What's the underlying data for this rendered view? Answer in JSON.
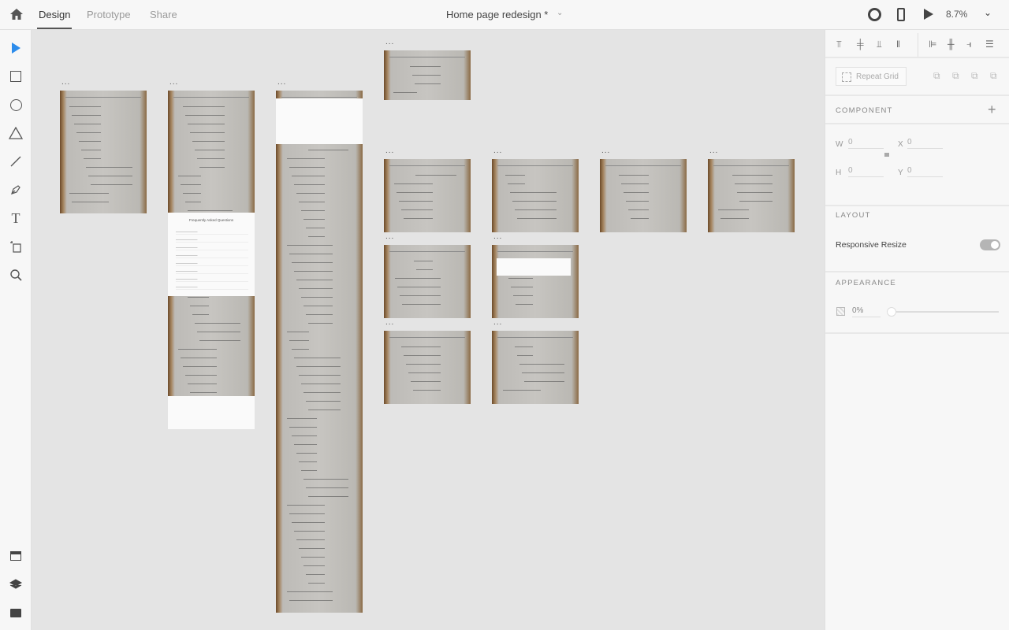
{
  "topbar": {
    "tabs": [
      {
        "label": "Design",
        "active": true
      },
      {
        "label": "Prototype"
      },
      {
        "label": "Share"
      }
    ],
    "document_title": "Home page redesign *",
    "zoom": "8.7%"
  },
  "tools": [
    "select",
    "rectangle",
    "ellipse",
    "triangle",
    "line",
    "pen",
    "text",
    "artboard",
    "zoom"
  ],
  "bottom_tools": [
    "assets",
    "layers",
    "plugins"
  ],
  "panel": {
    "repeat_grid": "Repeat Grid",
    "component": {
      "heading": "COMPONENT"
    },
    "transform": {
      "w_label": "W",
      "w": "0",
      "h_label": "H",
      "h": "0",
      "x_label": "X",
      "x": "0",
      "y_label": "Y",
      "y": "0"
    },
    "layout": {
      "heading": "LAYOUT",
      "responsive_resize": "Responsive Resize",
      "responsive_on": true
    },
    "appearance": {
      "heading": "APPEARANCE",
      "opacity": "0%"
    }
  },
  "artboard_menu": "...",
  "faq": {
    "title": "Frequently Asked Questions"
  },
  "accent": "#2d8ceb"
}
